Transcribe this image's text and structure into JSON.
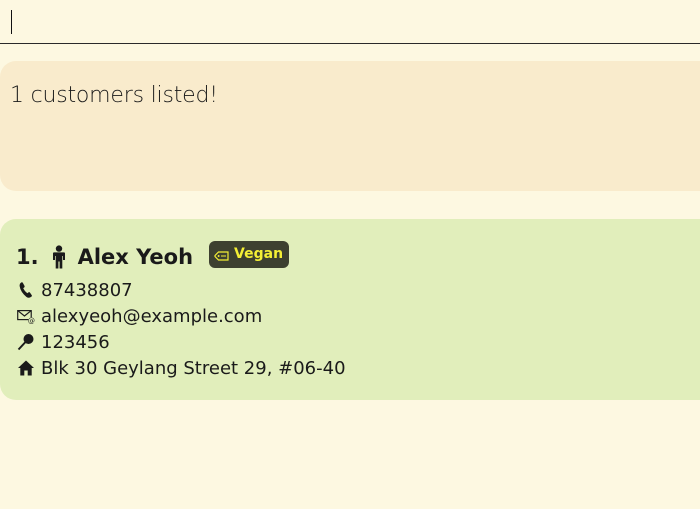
{
  "command": {
    "value": "",
    "placeholder": ""
  },
  "result": {
    "message": "1 customers listed!"
  },
  "customers": [
    {
      "index": "1.",
      "name": "Alex Yeoh",
      "tags": [
        "Vegan"
      ],
      "phone": "87438807",
      "email": "alexyeoh@example.com",
      "postal": "123456",
      "address": "Blk 30 Geylang Street 29, #06-40"
    }
  ],
  "icons": {
    "person": "person-icon",
    "tag": "tag-icon",
    "phone": "phone-icon",
    "email": "email-icon",
    "postal": "pin-icon",
    "address": "home-icon"
  },
  "colors": {
    "background": "#fdf8e1",
    "result_box": "#f9ebcc",
    "card": "#e1eebb",
    "tag_bg": "#3d4030",
    "tag_text": "#f4ef35"
  }
}
